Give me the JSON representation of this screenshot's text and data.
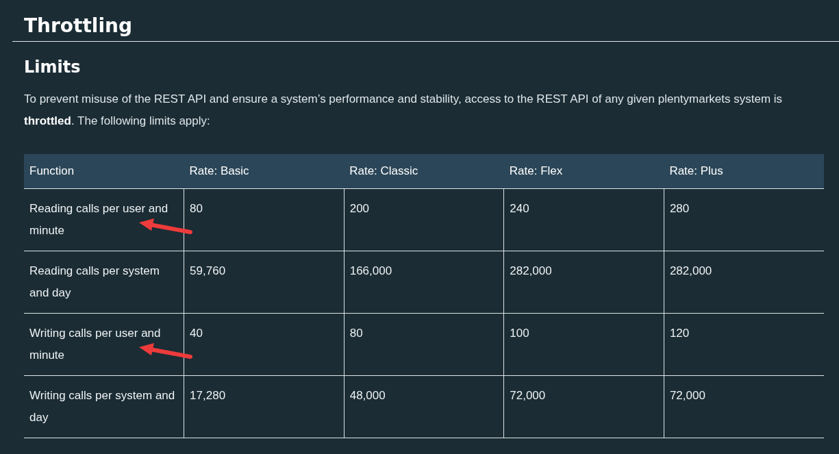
{
  "heading": "Throttling",
  "subheading": "Limits",
  "intro": "To prevent misuse of the REST API and ensure a system’s performance and stability, access to the REST API of any given plentymarkets system is **throttled**. The following limits apply:",
  "table": {
    "columns": [
      "Function",
      "Rate: Basic",
      "Rate: Classic",
      "Rate: Flex",
      "Rate: Plus"
    ],
    "rows": [
      {
        "cells": [
          "Reading calls per user and minute",
          "80",
          "200",
          "240",
          "280"
        ],
        "marked": true
      },
      {
        "cells": [
          "Reading calls per system and day",
          "59,760",
          "166,000",
          "282,000",
          "282,000"
        ],
        "marked": false
      },
      {
        "cells": [
          "Writing calls per user and minute",
          "40",
          "80",
          "100",
          "120"
        ],
        "marked": true
      },
      {
        "cells": [
          "Writing calls per system and day",
          "17,280",
          "48,000",
          "72,000",
          "72,000"
        ],
        "marked": false
      }
    ]
  }
}
